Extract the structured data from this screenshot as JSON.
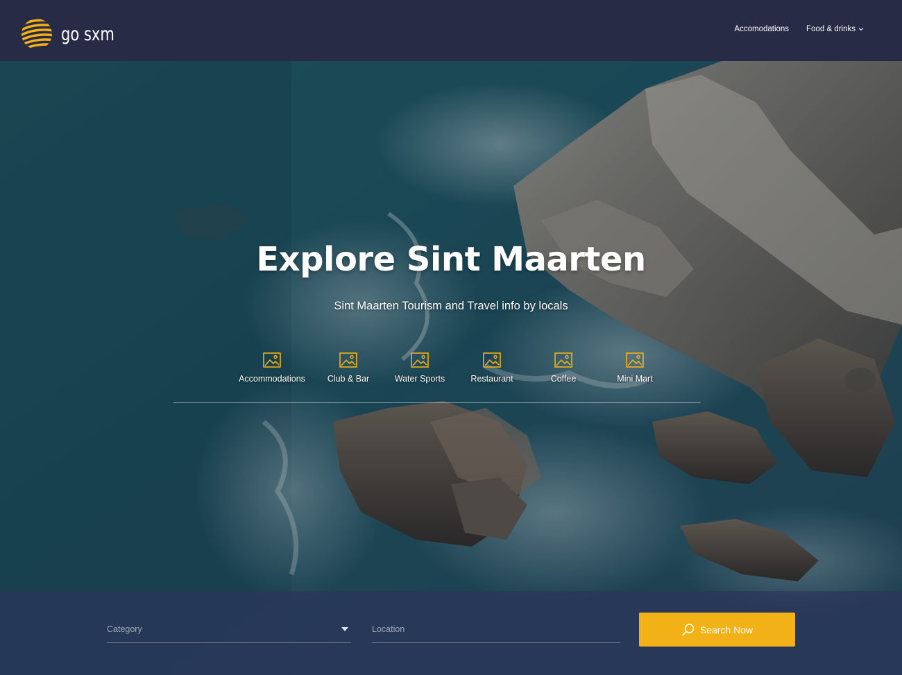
{
  "brand": {
    "name": "go sxm",
    "accent": "#f2b116",
    "header_bg": "#272b45"
  },
  "nav": {
    "items": [
      {
        "label": "Accomodations"
      },
      {
        "label": "Food & drinks",
        "has_dropdown": true,
        "icon": "chevron-down-icon"
      }
    ]
  },
  "hero": {
    "title": "Explore Sint Maarten",
    "subtitle": "Sint Maarten Tourism and Travel info by locals",
    "categories": [
      {
        "label": "Accommodations",
        "icon": "image-icon"
      },
      {
        "label": "Club & Bar",
        "icon": "image-icon"
      },
      {
        "label": "Water Sports",
        "icon": "image-icon"
      },
      {
        "label": "Restaurant",
        "icon": "image-icon"
      },
      {
        "label": "Coffee",
        "icon": "image-icon"
      },
      {
        "label": "Mini Mart",
        "icon": "image-icon"
      }
    ]
  },
  "search": {
    "category_placeholder": "Category",
    "location_placeholder": "Location",
    "button_label": "Search Now",
    "button_icon": "search-icon"
  }
}
